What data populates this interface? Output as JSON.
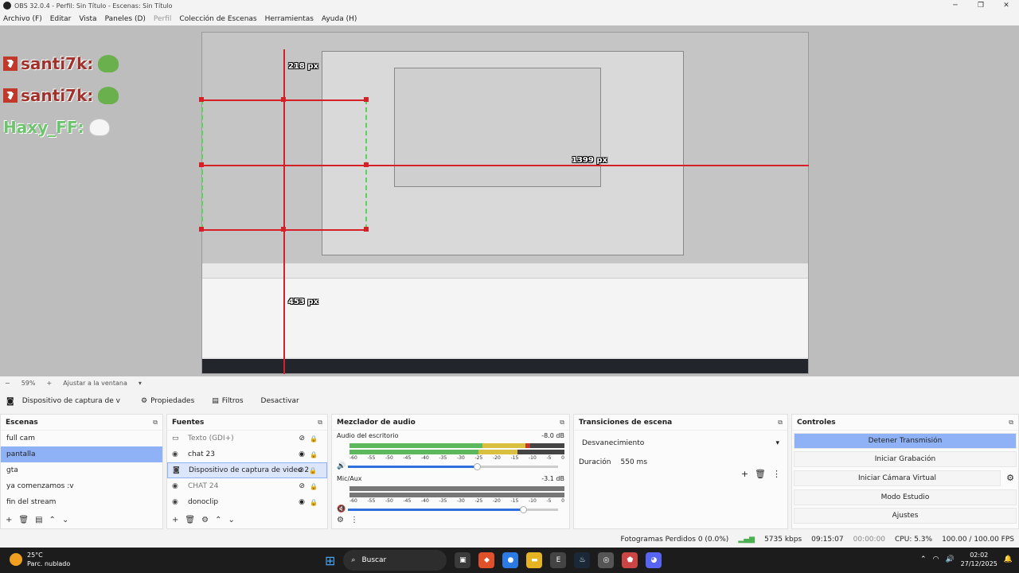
{
  "window": {
    "title": "OBS 32.0.4 - Perfil: Sin Título - Escenas: Sin Título",
    "controls": [
      "─",
      "❐",
      "✕"
    ]
  },
  "menu": [
    {
      "label": "Archivo (F)",
      "disabled": false
    },
    {
      "label": "Editar",
      "disabled": false
    },
    {
      "label": "Vista",
      "disabled": false
    },
    {
      "label": "Paneles (D)",
      "disabled": false
    },
    {
      "label": "Perfil",
      "disabled": true
    },
    {
      "label": "Colección de Escenas",
      "disabled": false
    },
    {
      "label": "Herramientas",
      "disabled": false
    },
    {
      "label": "Ayuda (H)",
      "disabled": false
    }
  ],
  "preview": {
    "chat": [
      {
        "user": "santi7k",
        "badge": "7",
        "emote": "pepe-emote"
      },
      {
        "user": "santi7k",
        "badge": "7",
        "emote": "pepe-emote"
      },
      {
        "user": "Haxy_FF",
        "badge": "",
        "emote": "goose-emote"
      }
    ],
    "labels": {
      "h1": "218 px",
      "h2": "1399 px",
      "v1": "453 px"
    }
  },
  "zoom": {
    "level": "59%",
    "fit": "Ajustar a la ventana"
  },
  "source_bar": {
    "source_name": "Dispositivo de captura de v",
    "properties": "Propiedades",
    "filters": "Filtros",
    "deactivate": "Desactivar"
  },
  "scenes": {
    "title": "Escenas",
    "items": [
      "full cam",
      "pantalla",
      "gta",
      "ya comenzamos :v",
      "fin del stream"
    ],
    "selected_index": 1
  },
  "sources": {
    "title": "Fuentes",
    "items": [
      {
        "name": "Texto (GDI+)",
        "visible": false,
        "icon": "text-icon"
      },
      {
        "name": "chat 23",
        "visible": true,
        "icon": "browser-icon"
      },
      {
        "name": "Dispositivo de captura de video 2",
        "visible": false,
        "icon": "camera-icon"
      },
      {
        "name": "CHAT 24",
        "visible": false,
        "icon": "browser-icon"
      },
      {
        "name": "donoclip",
        "visible": true,
        "icon": "browser-icon"
      }
    ],
    "selected_index": 2
  },
  "mixer": {
    "title": "Mezclador de audio",
    "channels": [
      {
        "name": "Audio del escritorio",
        "db": "-8.0 dB",
        "level": 0.82,
        "volume": 0.62,
        "muted": false
      },
      {
        "name": "Mic/Aux",
        "db": "-3.1 dB",
        "level": 0.0,
        "volume": 0.84,
        "muted": true
      }
    ],
    "ticks": [
      "-60",
      "-55",
      "-50",
      "-45",
      "-40",
      "-35",
      "-30",
      "-25",
      "-20",
      "-15",
      "-10",
      "-5",
      "0"
    ]
  },
  "transitions": {
    "title": "Transiciones de escena",
    "selected": "Desvanecimiento",
    "duration_label": "Duración",
    "duration_value": "550 ms"
  },
  "controls": {
    "title": "Controles",
    "buttons": [
      "Detener Transmisión",
      "Iniciar Grabación",
      "Iniciar Cámara Virtual",
      "Modo Estudio",
      "Ajustes"
    ]
  },
  "status": {
    "dropped": "Fotogramas Perdidos 0 (0.0%)",
    "bitrate": "5735 kbps",
    "stream_time": "09:15:07",
    "rec_time": "00:00:00",
    "cpu": "CPU: 5.3%",
    "fps": "100.00 / 100.00 FPS"
  },
  "taskbar": {
    "temp": "25°C",
    "weather": "Parc. nublado",
    "search": "Buscar",
    "time": "02:02",
    "date": "27/12/2025"
  },
  "colors": {
    "accent": "#8fb1f5",
    "red_guide": "#d61f26",
    "green_guide": "#55d455"
  }
}
